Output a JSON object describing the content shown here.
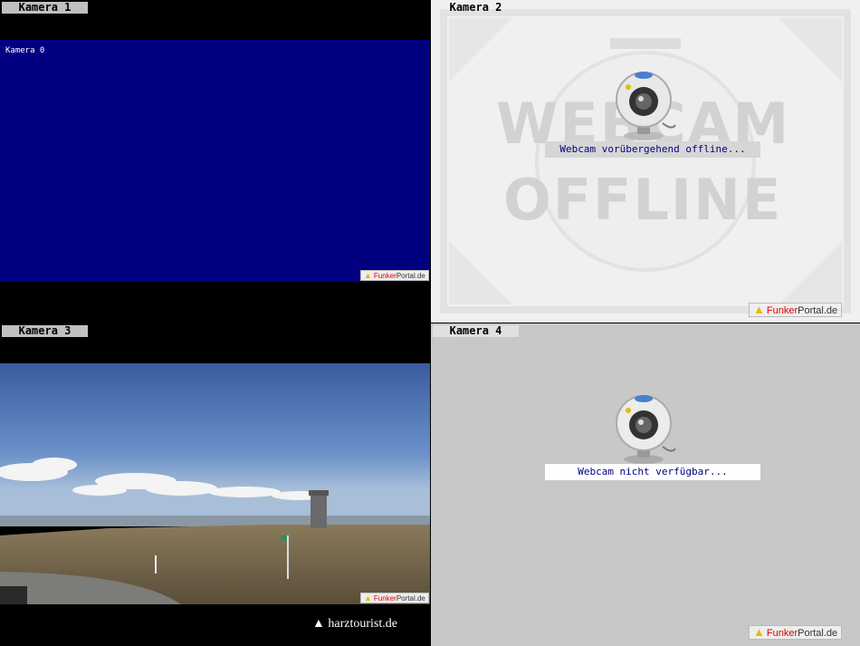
{
  "cameras": [
    {
      "label": "Kamera 1",
      "osd_text": "Kamera 0",
      "brand_a": "Funker",
      "brand_b": "Portal.de"
    },
    {
      "label": "Kamera 2",
      "overlay_text_1": "WEBCAM",
      "overlay_text_2": "OFFLINE",
      "status": "Webcam vorübergehend offline...",
      "brand_a": "Funker",
      "brand_b": "Portal.de"
    },
    {
      "label": "Kamera 3",
      "watermark": "harztourist.de",
      "brand_a": "Funker",
      "brand_b": "Portal.de"
    },
    {
      "label": "Kamera 4",
      "status": "Webcam nicht verfügbar...",
      "brand_a": "Funker",
      "brand_b": "Portal.de"
    }
  ],
  "colors": {
    "feed_blue": "#000080",
    "status_text": "#000080",
    "brand_red": "#e00000",
    "warning_yellow": "#e8b800"
  },
  "icons": [
    "webcam-icon",
    "warning-triangle-icon"
  ]
}
